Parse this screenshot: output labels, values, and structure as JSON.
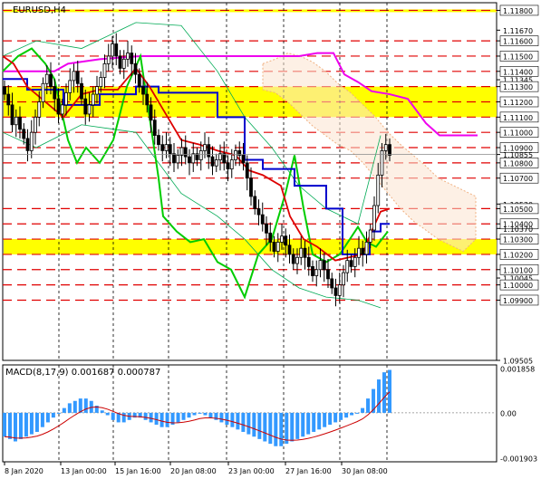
{
  "window": {
    "title": "EURUSD,H4"
  },
  "macd": {
    "title": "MACD(8,17,9) 0.001687 0.000787"
  },
  "colors": {
    "background": "#ffffff",
    "grid_dash": "#000000",
    "level_line": "#e00000",
    "zone": "#ffff00",
    "candle": "#000000",
    "kijun": "#0000cc",
    "tenkan": "#dd0000",
    "chikou": "#00cc00",
    "senkou_b": "#ee00ee",
    "cloud": "#f0b080",
    "macd_hist": "#3399ff",
    "macd_signal": "#cc0000",
    "bollinger": "#00aa55"
  },
  "price_axis": {
    "labels": [
      {
        "text": "1.11800",
        "value": 1.118,
        "boxed": true
      },
      {
        "text": "1.11670",
        "value": 1.1167
      },
      {
        "text": "1.11600",
        "value": 1.116,
        "boxed": true
      },
      {
        "text": "1.11500",
        "value": 1.115,
        "boxed": true
      },
      {
        "text": "1.11400",
        "value": 1.114,
        "boxed": true
      },
      {
        "text": "1.11345",
        "value": 1.11345
      },
      {
        "text": "1.11300",
        "value": 1.113,
        "boxed": true
      },
      {
        "text": "1.11200",
        "value": 1.112,
        "boxed": true
      },
      {
        "text": "1.11100",
        "value": 1.111,
        "boxed": true
      },
      {
        "text": "1.11000",
        "value": 1.11,
        "boxed": true
      },
      {
        "text": "1.10900",
        "value": 1.109,
        "boxed": true
      },
      {
        "text": "1.10855",
        "value": 1.10855
      },
      {
        "text": "1.10800",
        "value": 1.108,
        "boxed": true
      },
      {
        "text": "1.10700",
        "value": 1.107,
        "boxed": true
      },
      {
        "text": "1.10530",
        "value": 1.1053
      },
      {
        "text": "1.10500",
        "value": 1.105,
        "boxed": true
      },
      {
        "text": "1.10400",
        "value": 1.104,
        "boxed": true
      },
      {
        "text": "1.10370",
        "value": 1.1037
      },
      {
        "text": "1.10300",
        "value": 1.103,
        "boxed": true
      },
      {
        "text": "1.10200",
        "value": 1.102,
        "boxed": true
      },
      {
        "text": "1.10100",
        "value": 1.101,
        "boxed": true
      },
      {
        "text": "1.10045",
        "value": 1.10045
      },
      {
        "text": "1.10000",
        "value": 1.1,
        "boxed": true
      },
      {
        "text": "1.09900",
        "value": 1.099,
        "boxed": true
      },
      {
        "text": "1.09505",
        "value": 1.09505
      }
    ]
  },
  "macd_axis": {
    "labels": [
      {
        "text": "0.001858",
        "value": 0.001858
      },
      {
        "text": "0.00",
        "value": 0.0
      },
      {
        "text": "-0.001903",
        "value": -0.001903
      }
    ]
  },
  "time_axis": {
    "labels": [
      "8 Jan 2020",
      "13 Jan 00:00",
      "15 Jan 16:00",
      "20 Jan 08:00",
      "23 Jan 00:00",
      "27 Jan 16:00",
      "30 Jan 08:00"
    ]
  },
  "chart_data": {
    "type": "candlestick",
    "symbol": "EURUSD",
    "timeframe": "H4",
    "ylim": [
      1.09505,
      1.1185
    ],
    "x": [
      "8 Jan 2020",
      "13 Jan 00:00",
      "15 Jan 16:00",
      "20 Jan 08:00",
      "23 Jan 00:00",
      "27 Jan 16:00",
      "30 Jan 08:00"
    ],
    "horizontal_levels": [
      1.118,
      1.116,
      1.115,
      1.114,
      1.113,
      1.112,
      1.111,
      1.11,
      1.109,
      1.108,
      1.107,
      1.105,
      1.104,
      1.103,
      1.102,
      1.101,
      1.1,
      1.099
    ],
    "zones": [
      [
        1.111,
        1.113
      ],
      [
        1.102,
        1.103
      ]
    ],
    "current_price": 1.10855,
    "close": [
      1.1125,
      1.1118,
      1.1105,
      1.111,
      1.1102,
      1.1096,
      1.1088,
      1.11,
      1.111,
      1.112,
      1.1132,
      1.1138,
      1.113,
      1.1122,
      1.1112,
      1.1118,
      1.1126,
      1.1134,
      1.114,
      1.1132,
      1.1122,
      1.1112,
      1.1118,
      1.1125,
      1.113,
      1.1136,
      1.1145,
      1.115,
      1.1158,
      1.115,
      1.1142,
      1.1148,
      1.1152,
      1.1145,
      1.1138,
      1.113,
      1.1125,
      1.1118,
      1.1108,
      1.1098,
      1.1092,
      1.1088,
      1.1092,
      1.1086,
      1.108,
      1.1085,
      1.109,
      1.1084,
      1.108,
      1.1086,
      1.1082,
      1.1088,
      1.1092,
      1.1084,
      1.1078,
      1.1082,
      1.1086,
      1.108,
      1.1076,
      1.1082,
      1.1088,
      1.1085,
      1.108,
      1.107,
      1.1058,
      1.105,
      1.1046,
      1.104,
      1.1034,
      1.1028,
      1.1022,
      1.1028,
      1.1032,
      1.1026,
      1.102,
      1.1014,
      1.1018,
      1.1024,
      1.1018,
      1.1012,
      1.1006,
      1.101,
      1.1016,
      1.101,
      1.1004,
      1.0998,
      1.0993,
      1.1,
      1.1008,
      1.1016,
      1.1012,
      1.1018,
      1.1024,
      1.102,
      1.1028,
      1.1036,
      1.1052,
      1.1072,
      1.1088,
      1.1092,
      1.1085
    ],
    "macd": [
      -0.001,
      -0.0011,
      -0.0012,
      -0.0011,
      -0.001,
      -0.0009,
      -0.0008,
      -0.0006,
      -0.0004,
      -0.0002,
      0.0,
      0.0002,
      0.0004,
      0.0005,
      0.0006,
      0.0006,
      0.0005,
      0.0003,
      0.0001,
      -0.0001,
      -0.0003,
      -0.0004,
      -0.0004,
      -0.0003,
      -0.0002,
      -0.0002,
      -0.0003,
      -0.0004,
      -0.0005,
      -0.0006,
      -0.0006,
      -0.0005,
      -0.0004,
      -0.0003,
      -0.0002,
      -0.0001,
      0.0,
      -0.0001,
      -0.0002,
      -0.0003,
      -0.0004,
      -0.0005,
      -0.0006,
      -0.0007,
      -0.0008,
      -0.0009,
      -0.001,
      -0.0011,
      -0.0012,
      -0.0013,
      -0.0014,
      -0.0014,
      -0.0013,
      -0.0012,
      -0.0011,
      -0.001,
      -0.0009,
      -0.0008,
      -0.0007,
      -0.0006,
      -0.0005,
      -0.0004,
      -0.0003,
      -0.0002,
      -0.0001,
      0.0,
      0.0002,
      0.0006,
      0.001,
      0.0014,
      0.0017,
      0.0018
    ]
  }
}
